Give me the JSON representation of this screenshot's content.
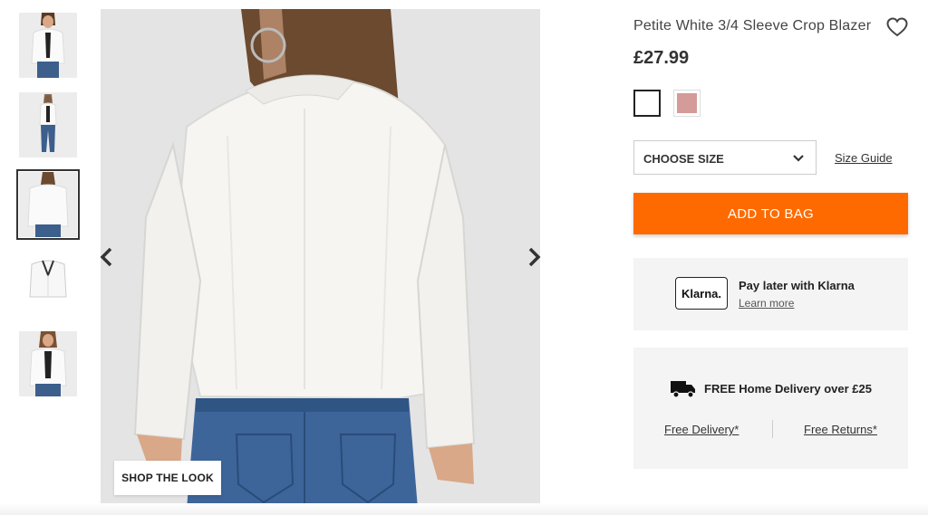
{
  "product": {
    "title": "Petite White 3/4 Sleeve Crop Blazer",
    "price": "£27.99"
  },
  "gallery": {
    "shop_the_look": "SHOP THE LOOK",
    "selected_index": 2,
    "thumbnail_count": 5
  },
  "swatches": [
    {
      "name": "White",
      "color": "#ffffff",
      "selected": true
    },
    {
      "name": "Pink",
      "color": "#d49b98",
      "selected": false
    }
  ],
  "size": {
    "select_label": "CHOOSE SIZE",
    "guide_label": "Size Guide"
  },
  "cart": {
    "add_label": "ADD TO BAG",
    "accent_color": "#ff6a00"
  },
  "klarna": {
    "logo_text": "Klarna.",
    "title": "Pay later with Klarna",
    "link": "Learn more"
  },
  "delivery": {
    "headline": "FREE Home Delivery over £25",
    "free_delivery_link": "Free Delivery*",
    "free_returns_link": "Free Returns*"
  },
  "icons": [
    "heart-icon",
    "chevron-down-icon",
    "chevron-left-icon",
    "chevron-right-icon",
    "truck-icon"
  ]
}
